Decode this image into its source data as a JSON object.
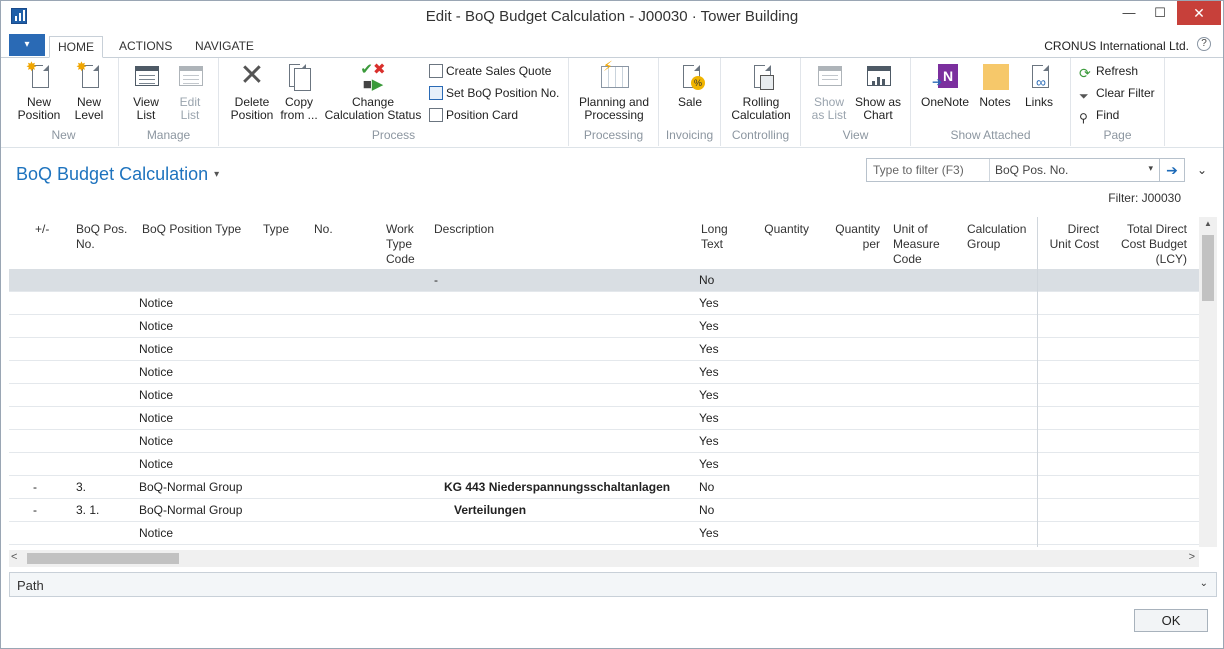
{
  "window": {
    "title": "Edit - BoQ Budget Calculation - J00030 · Tower Building",
    "minimize": "—",
    "maximize": "☐",
    "close": "✕"
  },
  "tabs": {
    "menu_icon": "▾",
    "items": [
      "HOME",
      "ACTIONS",
      "NAVIGATE"
    ],
    "active": "HOME"
  },
  "company": "CRONUS International Ltd.",
  "help_icon": "?",
  "ribbon": {
    "new": {
      "label": "New",
      "new_position": [
        "New",
        "Position"
      ],
      "new_level": [
        "New",
        "Level"
      ]
    },
    "manage": {
      "label": "Manage",
      "view_list": [
        "View",
        "List"
      ],
      "edit_list": [
        "Edit",
        "List"
      ]
    },
    "process": {
      "label": "Process",
      "delete_position": [
        "Delete",
        "Position"
      ],
      "copy_from": [
        "Copy",
        "from ..."
      ],
      "change_status": [
        "Change",
        "Calculation Status"
      ],
      "create_sales_quote": "Create Sales Quote",
      "set_boq_position_no": "Set BoQ Position No.",
      "position_card": "Position Card"
    },
    "processing": {
      "label": "Processing",
      "planning": [
        "Planning and",
        "Processing"
      ]
    },
    "invoicing": {
      "label": "Invoicing",
      "sale": "Sale"
    },
    "controlling": {
      "label": "Controlling",
      "rolling": [
        "Rolling",
        "Calculation"
      ]
    },
    "view": {
      "label": "View",
      "show_as_list": [
        "Show",
        "as List"
      ],
      "show_as_chart": [
        "Show as",
        "Chart"
      ]
    },
    "show_attached": {
      "label": "Show Attached",
      "onenote": "OneNote",
      "notes": "Notes",
      "links": "Links"
    },
    "page": {
      "label": "Page",
      "refresh": "Refresh",
      "clear_filter": "Clear Filter",
      "find": "Find"
    }
  },
  "page": {
    "title": "BoQ Budget Calculation",
    "title_caret": "▾",
    "filter_placeholder": "Type to filter (F3)",
    "filter_field": "BoQ Pos. No.",
    "filter_dropdown": "▾",
    "filter_go": "➔",
    "collapse": "⌄",
    "filter_label": "Filter: J00030"
  },
  "grid": {
    "columns": {
      "plusminus": [
        "+/-"
      ],
      "boq_pos_no": [
        "BoQ Pos.",
        "No."
      ],
      "position_type": [
        "BoQ Position Type"
      ],
      "type": [
        "Type"
      ],
      "no": [
        "No."
      ],
      "work_type_code": [
        "Work",
        "Type",
        "Code"
      ],
      "description": [
        "Description"
      ],
      "long_text": [
        "Long",
        "Text"
      ],
      "quantity": [
        "Quantity"
      ],
      "quantity_per": [
        "Quantity",
        "per"
      ],
      "uom": [
        "Unit of",
        "Measure",
        "Code"
      ],
      "calc_group": [
        "Calculation",
        "Group"
      ],
      "direct_unit_cost": [
        "Direct",
        "Unit Cost"
      ],
      "total_direct_cost": [
        "Total Direct",
        "Cost Budget",
        "(LCY)"
      ]
    },
    "rows": [
      {
        "pm": "",
        "pos": "",
        "ptype": "",
        "desc": "-",
        "desc_bold": false,
        "long_text": "No",
        "selected": true
      },
      {
        "pm": "",
        "pos": "",
        "ptype": "Notice",
        "desc": "",
        "desc_bold": false,
        "long_text": "Yes",
        "selected": false
      },
      {
        "pm": "",
        "pos": "",
        "ptype": "Notice",
        "desc": "",
        "desc_bold": false,
        "long_text": "Yes",
        "selected": false
      },
      {
        "pm": "",
        "pos": "",
        "ptype": "Notice",
        "desc": "",
        "desc_bold": false,
        "long_text": "Yes",
        "selected": false
      },
      {
        "pm": "",
        "pos": "",
        "ptype": "Notice",
        "desc": "",
        "desc_bold": false,
        "long_text": "Yes",
        "selected": false
      },
      {
        "pm": "",
        "pos": "",
        "ptype": "Notice",
        "desc": "",
        "desc_bold": false,
        "long_text": "Yes",
        "selected": false
      },
      {
        "pm": "",
        "pos": "",
        "ptype": "Notice",
        "desc": "",
        "desc_bold": false,
        "long_text": "Yes",
        "selected": false
      },
      {
        "pm": "",
        "pos": "",
        "ptype": "Notice",
        "desc": "",
        "desc_bold": false,
        "long_text": "Yes",
        "selected": false
      },
      {
        "pm": "",
        "pos": "",
        "ptype": "Notice",
        "desc": "",
        "desc_bold": false,
        "long_text": "Yes",
        "selected": false
      },
      {
        "pm": "-",
        "pos": "3.",
        "ptype": "BoQ-Normal Group",
        "desc": "KG 443 Niederspannungsschaltanlagen",
        "desc_bold": true,
        "long_text": "No",
        "selected": false
      },
      {
        "pm": "-",
        "pos": "3. 1.",
        "ptype": "BoQ-Normal Group",
        "desc": "Verteilungen",
        "desc_bold": true,
        "long_text": "No",
        "selected": false
      },
      {
        "pm": "",
        "pos": "",
        "ptype": "Notice",
        "desc": "",
        "desc_bold": false,
        "long_text": "Yes",
        "selected": false
      }
    ]
  },
  "scroll": {
    "left": "<",
    "right": ">",
    "up": "▲"
  },
  "path": {
    "label": "Path",
    "chevron": "⌄"
  },
  "ok_label": "OK"
}
